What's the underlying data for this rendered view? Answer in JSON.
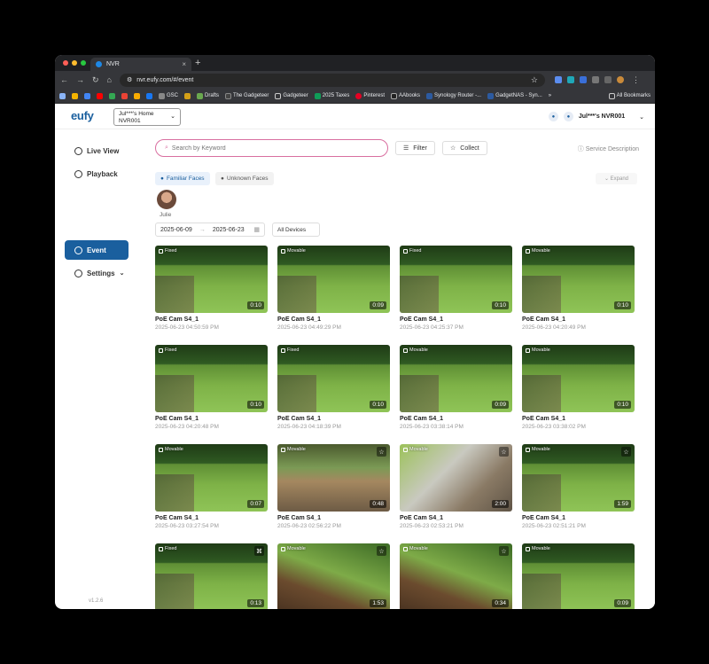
{
  "browser": {
    "tab_title": "NVR",
    "url": "nvr.eufy.com/#/event",
    "bookmarks": [
      "GSC",
      "Drafts",
      "The Gadgeteer",
      "Gadgeteer",
      "2025 Taxes",
      "Pinterest",
      "AAbooks",
      "Synology Router -...",
      "GadgetNAS - Syn..."
    ],
    "all_bookmarks": "All Bookmarks",
    "more": "»"
  },
  "header": {
    "logo": "eufy",
    "home_line1": "Jul***'s Home",
    "home_line2": "NVR001",
    "account": "Jul***'s NVR001"
  },
  "sidebar": {
    "items": [
      {
        "label": "Live View"
      },
      {
        "label": "Playback"
      },
      {
        "label": "Event"
      },
      {
        "label": "Settings"
      }
    ],
    "version": "v1.2.6"
  },
  "toolbar": {
    "search_placeholder": "Search by Keyword",
    "filter": "Filter",
    "collect": "Collect",
    "service": "Service Description"
  },
  "faces": {
    "familiar": "Familiar Faces",
    "unknown": "Unknown Faces",
    "expand": "Expand",
    "person": "Julie"
  },
  "filters": {
    "date_from": "2025-06-09",
    "date_to": "2025-06-23",
    "device": "All Devices"
  },
  "events": [
    {
      "tag": "Fixed",
      "dur": "0:10",
      "cam": "PoE Cam S4_1",
      "time": "2025-06-23 04:50:59 PM"
    },
    {
      "tag": "Movable",
      "dur": "0:09",
      "cam": "PoE Cam S4_1",
      "time": "2025-06-23 04:49:29 PM"
    },
    {
      "tag": "Fixed",
      "dur": "0:10",
      "cam": "PoE Cam S4_1",
      "time": "2025-06-23 04:25:37 PM"
    },
    {
      "tag": "Movable",
      "dur": "0:10",
      "cam": "PoE Cam S4_1",
      "time": "2025-06-23 04:20:49 PM"
    },
    {
      "tag": "Fixed",
      "dur": "0:10",
      "cam": "PoE Cam S4_1",
      "time": "2025-06-23 04:20:48 PM"
    },
    {
      "tag": "Fixed",
      "dur": "0:10",
      "cam": "PoE Cam S4_1",
      "time": "2025-06-23 04:18:39 PM"
    },
    {
      "tag": "Movable",
      "dur": "0:09",
      "cam": "PoE Cam S4_1",
      "time": "2025-06-23 03:38:14 PM"
    },
    {
      "tag": "Movable",
      "dur": "0:10",
      "cam": "PoE Cam S4_1",
      "time": "2025-06-23 03:38:02 PM"
    },
    {
      "tag": "Movable",
      "dur": "0:07",
      "cam": "PoE Cam S4_1",
      "time": "2025-06-23 03:27:54 PM"
    },
    {
      "tag": "Movable",
      "dur": "0:48",
      "cam": "PoE Cam S4_1",
      "time": "2025-06-23 02:56:22 PM"
    },
    {
      "tag": "Movable",
      "dur": "2:00",
      "cam": "PoE Cam S4_1",
      "time": "2025-06-23 02:53:21 PM"
    },
    {
      "tag": "Movable",
      "dur": "1:59",
      "cam": "PoE Cam S4_1",
      "time": "2025-06-23 02:51:21 PM"
    },
    {
      "tag": "Fixed",
      "dur": "0:13",
      "cam": "",
      "time": ""
    },
    {
      "tag": "Movable",
      "dur": "1:53",
      "cam": "",
      "time": ""
    },
    {
      "tag": "Movable",
      "dur": "0:34",
      "cam": "",
      "time": ""
    },
    {
      "tag": "Movable",
      "dur": "0:09",
      "cam": "",
      "time": ""
    }
  ],
  "colors": {
    "brand": "#1a5f9e",
    "search_border": "#d96fa0"
  }
}
